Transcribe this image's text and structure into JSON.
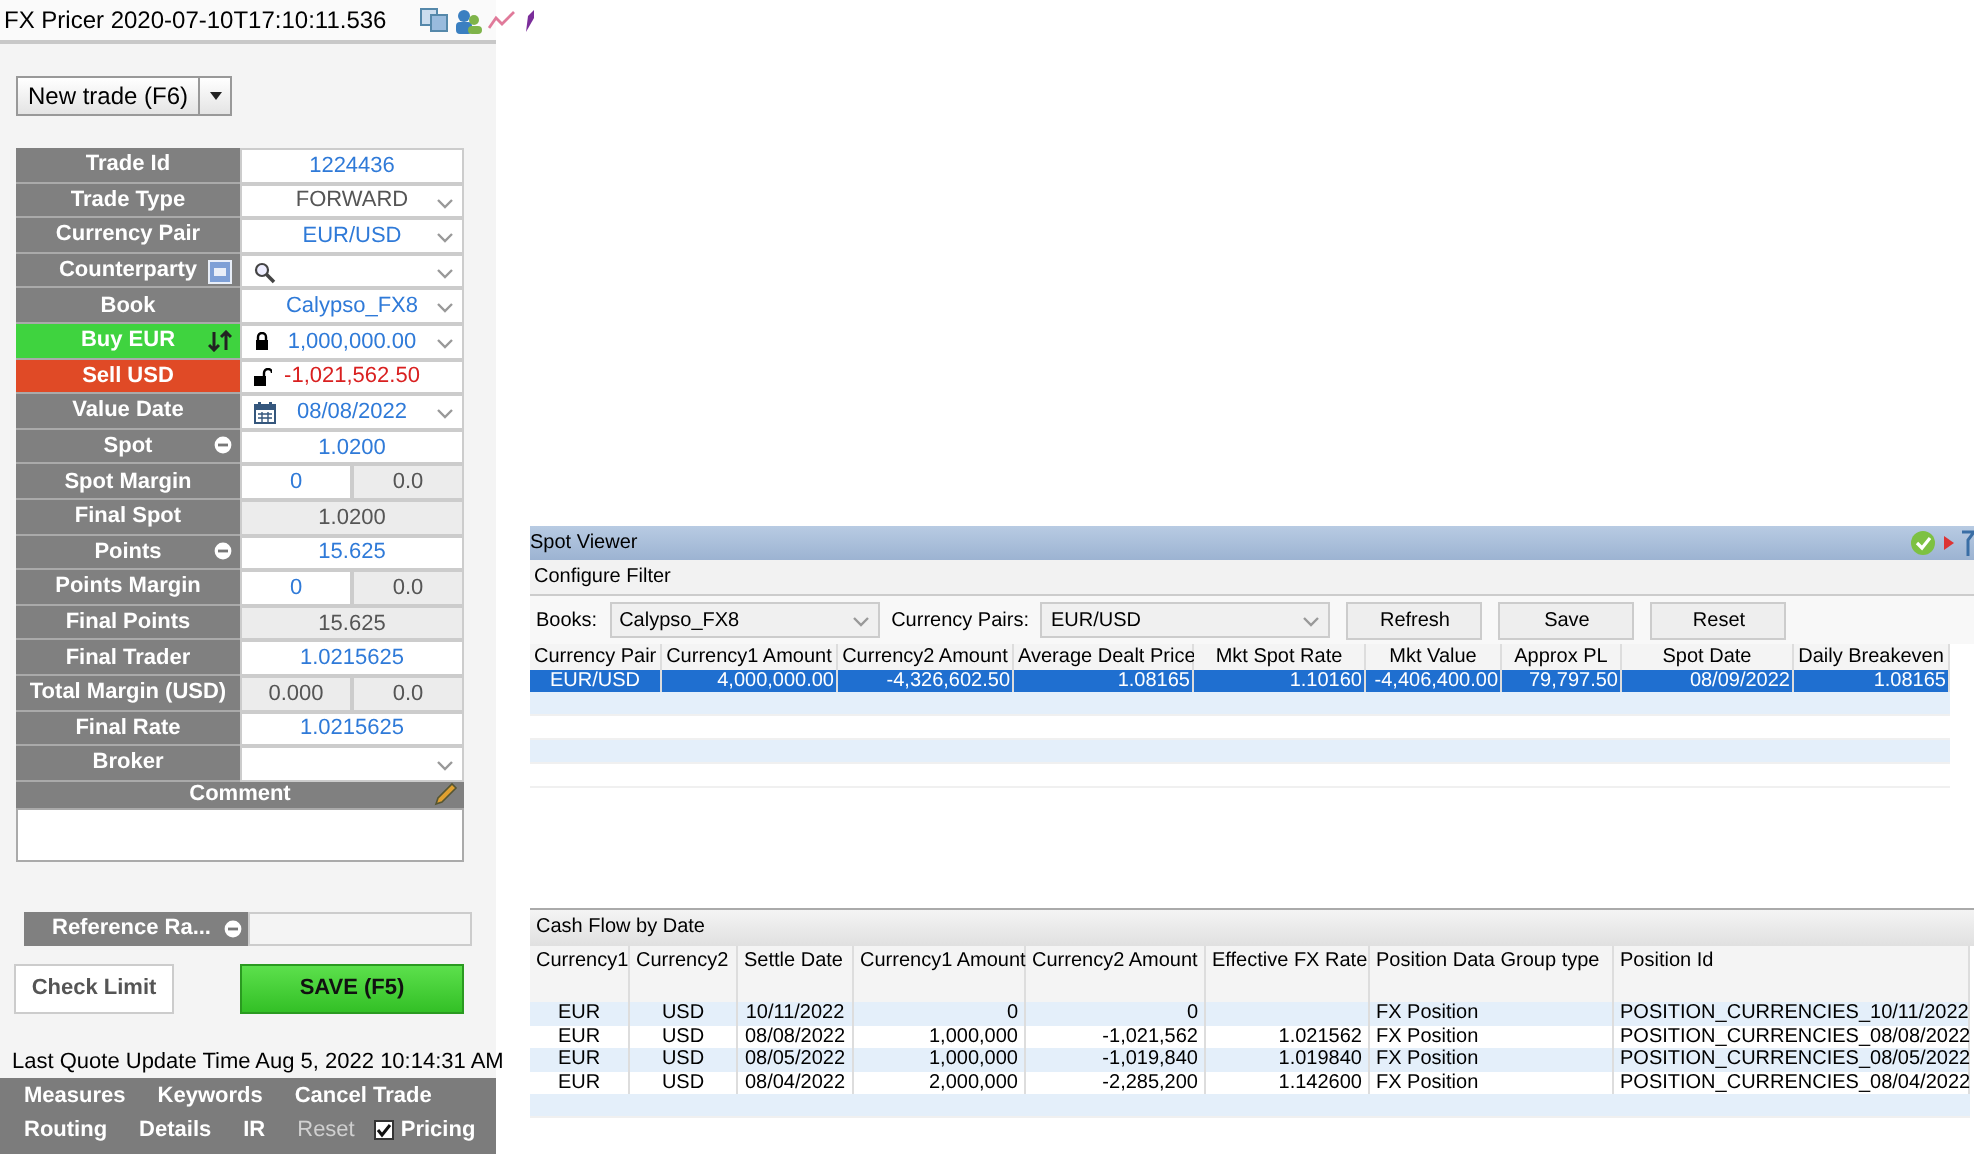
{
  "window": {
    "title": "FX Pricer 2020-07-10T17:10:11.536"
  },
  "new_trade_button": {
    "label": "New trade (F6)"
  },
  "form": {
    "rows": [
      {
        "label": "Trade Id",
        "kind": "plain",
        "value": "1224436",
        "color": "#2f7ad8",
        "editable": true,
        "dropdown": false
      },
      {
        "label": "Trade Type",
        "kind": "plain",
        "value": "FORWARD",
        "color": "#555555",
        "editable": true,
        "dropdown": true
      },
      {
        "label": "Currency Pair",
        "kind": "plain",
        "value": "EUR/USD",
        "color": "#2f7ad8",
        "editable": true,
        "dropdown": true
      },
      {
        "label": "Counterparty",
        "kind": "party",
        "editable": true,
        "dropdown": true
      },
      {
        "label": "Book",
        "kind": "plain",
        "value": "Calypso_FX8",
        "color": "#2f7ad8",
        "editable": true,
        "dropdown": true
      },
      {
        "label": "Buy EUR",
        "kind": "buy",
        "locked": true,
        "value": "1,000,000.00",
        "color": "#2f7ad8",
        "editable": true,
        "dropdown": true
      },
      {
        "label": "Sell USD",
        "kind": "sell",
        "locked": false,
        "value": "-1,021,562.50",
        "color": "#d92020",
        "editable": true,
        "dropdown": false
      },
      {
        "label": "Value Date",
        "kind": "date",
        "value": "08/08/2022",
        "color": "#2f7ad8",
        "editable": true,
        "dropdown": true
      },
      {
        "label": "Spot",
        "kind": "adjustable",
        "value": "1.0200",
        "color": "#2f7ad8",
        "editable": true,
        "dropdown": false
      },
      {
        "label": "Spot Margin",
        "kind": "plain",
        "value": "0",
        "value2": "0.0",
        "color": "#2f7ad8",
        "editable": true,
        "dropdown": false
      },
      {
        "label": "Final Spot",
        "kind": "plain",
        "value": "1.0200",
        "color": "#555555",
        "editable": false,
        "dropdown": false
      },
      {
        "label": "Points",
        "kind": "adjustable",
        "value": "15.625",
        "color": "#2f7ad8",
        "editable": true,
        "dropdown": false
      },
      {
        "label": "Points Margin",
        "kind": "plain",
        "value": "0",
        "value2": "0.0",
        "color": "#2f7ad8",
        "editable": true,
        "dropdown": false
      },
      {
        "label": "Final Points",
        "kind": "plain",
        "value": "15.625",
        "color": "#555555",
        "editable": false,
        "dropdown": false
      },
      {
        "label": "Final Trader",
        "kind": "plain",
        "value": "1.0215625",
        "color": "#2f7ad8",
        "editable": true,
        "dropdown": false
      },
      {
        "label": "Total Margin (USD)",
        "kind": "plain",
        "value": "0.000",
        "value2": "0.0",
        "color": "#555555",
        "editable": false,
        "dropdown": false
      },
      {
        "label": "Final Rate",
        "kind": "plain",
        "value": "1.0215625",
        "color": "#2f7ad8",
        "editable": true,
        "dropdown": false
      },
      {
        "label": "Broker",
        "kind": "plain",
        "editable": true,
        "dropdown": true
      }
    ],
    "comment": {
      "label": "Comment"
    }
  },
  "reference_rate": {
    "label": "Reference Ra..."
  },
  "check_limit_button": {
    "label": "Check Limit"
  },
  "save_button": {
    "label": "SAVE (F5)"
  },
  "last_quote": "Last Quote Update Time Aug 5, 2022 10:14:31 AM",
  "menu": [
    [
      {
        "kind": "link",
        "label": "Measures",
        "disabled": false
      },
      {
        "kind": "link",
        "label": "Keywords",
        "disabled": false
      },
      {
        "kind": "link",
        "label": "Cancel Trade",
        "disabled": false
      }
    ],
    [
      {
        "kind": "link",
        "label": "Routing",
        "disabled": false
      },
      {
        "kind": "link",
        "label": "Details",
        "disabled": false
      },
      {
        "kind": "link",
        "label": "IR",
        "disabled": false
      },
      {
        "kind": "link",
        "label": "Reset",
        "disabled": true
      },
      {
        "kind": "checkbox",
        "label": "Pricing",
        "checked": true
      }
    ]
  ],
  "spot_viewer": {
    "title": "Spot Viewer",
    "configure_filter": "Configure Filter",
    "books": {
      "label": "Books:",
      "value": "Calypso_FX8"
    },
    "currency_pairs": {
      "label": "Currency Pairs:",
      "value": "EUR/USD"
    },
    "buttons": [
      "Refresh",
      "Save",
      "Reset"
    ],
    "table": {
      "columns": [
        "Currency Pair",
        "Currency1 Amount",
        "Currency2 Amount",
        "Average Dealt Price",
        "Mkt Spot Rate",
        "Mkt Value",
        "Approx PL",
        "Spot Date",
        "Daily Breakeven"
      ],
      "rows": [
        {
          "selected": true,
          "cells": [
            "EUR/USD",
            "4,000,000.00",
            "-4,326,602.50",
            "1.08165",
            "1.10160",
            "-4,406,400.00",
            "79,797.50",
            "08/09/2022",
            "1.08165"
          ]
        }
      ]
    }
  },
  "cash_flow": {
    "title": "Cash Flow by Date",
    "table": {
      "columns": [
        "Currency1",
        "Currency2",
        "Settle Date",
        "Currency1 Amount",
        "Currency2 Amount",
        "Effective FX Rate",
        "Position Data Group type",
        "Position Id"
      ],
      "rows": [
        [
          "EUR",
          "USD",
          "10/11/2022",
          "0",
          "0",
          null,
          "FX Position",
          "POSITION_CURRENCIES_10/11/2022"
        ],
        [
          "EUR",
          "USD",
          "08/08/2022",
          "1,000,000",
          "-1,021,562",
          "1.021562",
          "FX Position",
          "POSITION_CURRENCIES_08/08/2022"
        ],
        [
          "EUR",
          "USD",
          "08/05/2022",
          "1,000,000",
          "-1,019,840",
          "1.019840",
          "FX Position",
          "POSITION_CURRENCIES_08/05/2022"
        ],
        [
          "EUR",
          "USD",
          "08/04/2022",
          "2,000,000",
          "-2,285,200",
          "1.142600",
          "FX Position",
          "POSITION_CURRENCIES_08/04/2022"
        ]
      ]
    }
  }
}
